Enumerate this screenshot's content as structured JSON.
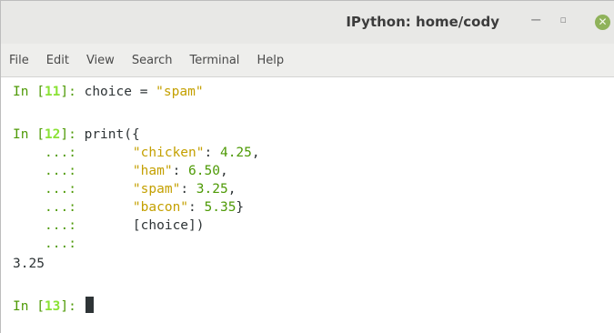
{
  "window": {
    "title": "IPython: home/cody",
    "controls": {
      "minimize": "−",
      "maximize": "▫",
      "close": "✕"
    }
  },
  "menu": [
    "File",
    "Edit",
    "View",
    "Search",
    "Terminal",
    "Help"
  ],
  "session": {
    "in11": {
      "prompt_open": "In [",
      "num": "11",
      "prompt_close": "]: ",
      "code": "choice = ",
      "str": "\"spam\""
    },
    "in12": {
      "prompt_open": "In [",
      "num": "12",
      "prompt_close": "]: ",
      "code": "print({"
    },
    "cont_prompt": "...:",
    "lines": [
      {
        "key": "\"chicken\"",
        "sep": ": ",
        "val": "4.25",
        "end": ","
      },
      {
        "key": "\"ham\"",
        "sep": ": ",
        "val": "6.50",
        "end": ","
      },
      {
        "key": "\"spam\"",
        "sep": ": ",
        "val": "3.25",
        "end": ","
      },
      {
        "key": "\"bacon\"",
        "sep": ": ",
        "val": "5.35",
        "end": "}"
      }
    ],
    "index_line": "[choice])",
    "output": "3.25",
    "in13": {
      "prompt_open": "In [",
      "num": "13",
      "prompt_close": "]: "
    }
  }
}
